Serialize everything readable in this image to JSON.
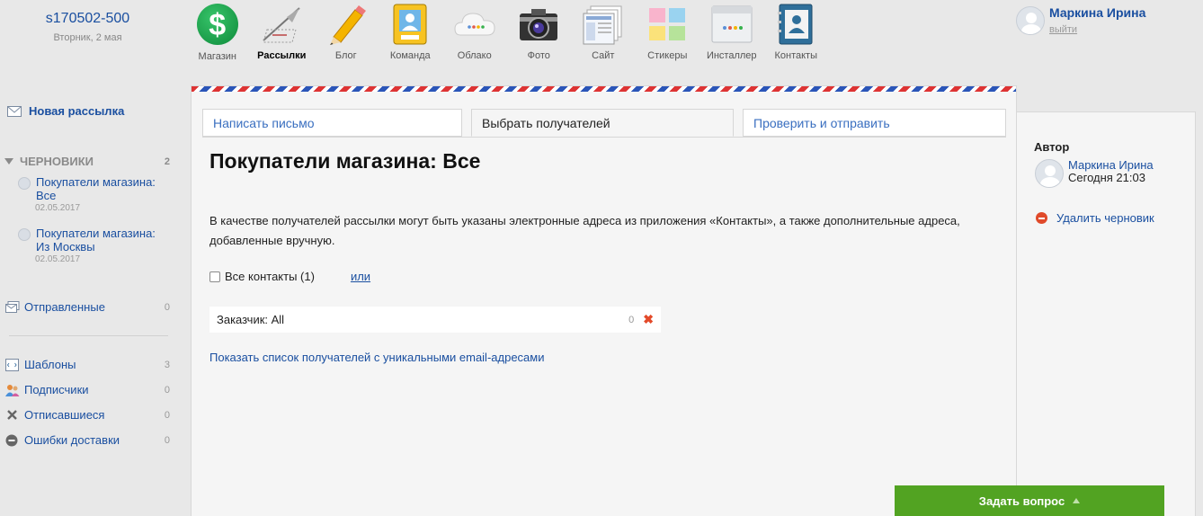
{
  "account": {
    "name": "s170502-500",
    "date": "Вторник, 2 мая"
  },
  "apps": [
    {
      "label": "Магазин",
      "icon": "dollar-icon",
      "active": false
    },
    {
      "label": "Рассылки",
      "icon": "mailer-icon",
      "active": true
    },
    {
      "label": "Блог",
      "icon": "pencil-icon",
      "active": false
    },
    {
      "label": "Команда",
      "icon": "team-card-icon",
      "active": false
    },
    {
      "label": "Облако",
      "icon": "cloud-icon",
      "active": false
    },
    {
      "label": "Фото",
      "icon": "camera-icon",
      "active": false
    },
    {
      "label": "Сайт",
      "icon": "site-icon",
      "active": false
    },
    {
      "label": "Стикеры",
      "icon": "stickers-icon",
      "active": false
    },
    {
      "label": "Инсталлер",
      "icon": "installer-icon",
      "active": false
    },
    {
      "label": "Контакты",
      "icon": "contacts-book-icon",
      "active": false
    }
  ],
  "user": {
    "name": "Маркина Ирина",
    "logout": "выйти"
  },
  "sidebar": {
    "new_message": "Новая рассылка",
    "drafts": {
      "label": "ЧЕРНОВИКИ",
      "count": "2",
      "items": [
        {
          "title_line1": "Покупатели магазина:",
          "title_line2": "Все",
          "date": "02.05.2017"
        },
        {
          "title_line1": "Покупатели магазина:",
          "title_line2": "Из Москвы",
          "date": "02.05.2017"
        }
      ]
    },
    "sent": {
      "label": "Отправленные",
      "count": "0"
    },
    "templates": {
      "label": "Шаблоны",
      "count": "3"
    },
    "subscribers": {
      "label": "Подписчики",
      "count": "0"
    },
    "unsubscribed": {
      "label": "Отписавшиеся",
      "count": "0"
    },
    "errors": {
      "label": "Ошибки доставки",
      "count": "0"
    }
  },
  "tabs": {
    "write": "Написать письмо",
    "recipients": "Выбрать получателей",
    "send": "Проверить и отправить"
  },
  "main": {
    "title": "Покупатели магазина: Все",
    "description": "В качестве получателей рассылки могут быть указаны электронные адреса из приложения «Контакты», а также дополнительные адреса, добавленные вручную.",
    "all_contacts": "Все контакты (1)",
    "or": "или",
    "recipient_row": {
      "label": "Заказчик: All",
      "count": "0"
    },
    "show_unique": "Показать список получателей с уникальными email-адресами"
  },
  "right": {
    "author_heading": "Автор",
    "author_name": "Маркина Ирина",
    "author_time": "Сегодня 21:03",
    "delete_draft": "Удалить черновик"
  },
  "help": {
    "label": "Задать вопрос"
  },
  "colors": {
    "accent": "#1a4fa0",
    "help_green": "#52a322",
    "delete_red": "#e04a2a"
  }
}
